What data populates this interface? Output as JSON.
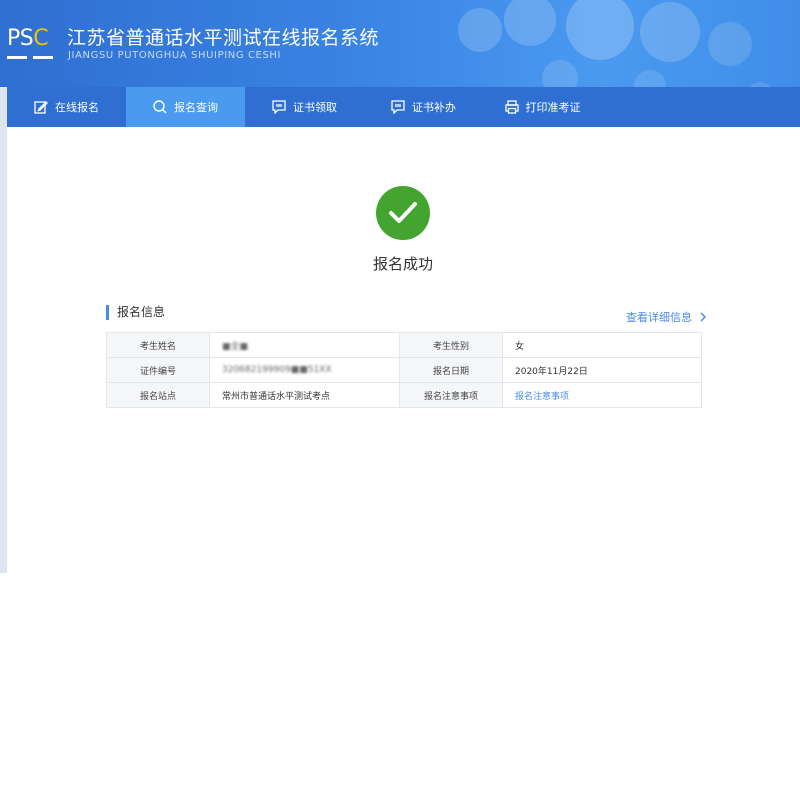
{
  "header": {
    "logo_prefix": "PS",
    "logo_accent": "C",
    "title": "江苏省普通话水平测试在线报名系统",
    "subtitle": "JIANGSU PUTONGHUA SHUIPING CESHI"
  },
  "nav": {
    "items": [
      {
        "label": "在线报名",
        "icon": "edit-icon",
        "active": false
      },
      {
        "label": "报名查询",
        "icon": "search-icon",
        "active": true
      },
      {
        "label": "证书领取",
        "icon": "message-icon",
        "active": false
      },
      {
        "label": "证书补办",
        "icon": "message-icon",
        "active": false
      },
      {
        "label": "打印准考证",
        "icon": "printer-icon",
        "active": false
      }
    ]
  },
  "result": {
    "icon": "check-icon",
    "text": "报名成功"
  },
  "info": {
    "section_title": "报名信息",
    "detail_link": "查看详细信息",
    "rows": [
      {
        "label1": "考生姓名",
        "value1": "■全■",
        "label2": "考生性别",
        "value2": "女"
      },
      {
        "label1": "证件编号",
        "value1": "320682199909■■51XX",
        "label2": "报名日期",
        "value2": "2020年11月22日"
      },
      {
        "label1": "报名站点",
        "value1": "常州市普通话水平测试考点",
        "label2": "报名注意事项",
        "value2": "报名注意事项"
      }
    ]
  },
  "colors": {
    "header_blue": "#2f6fd2",
    "active_tab": "#4a9af0",
    "success_green": "#43a52f",
    "link_blue": "#4a8be6",
    "logo_yellow": "#f5c000"
  }
}
